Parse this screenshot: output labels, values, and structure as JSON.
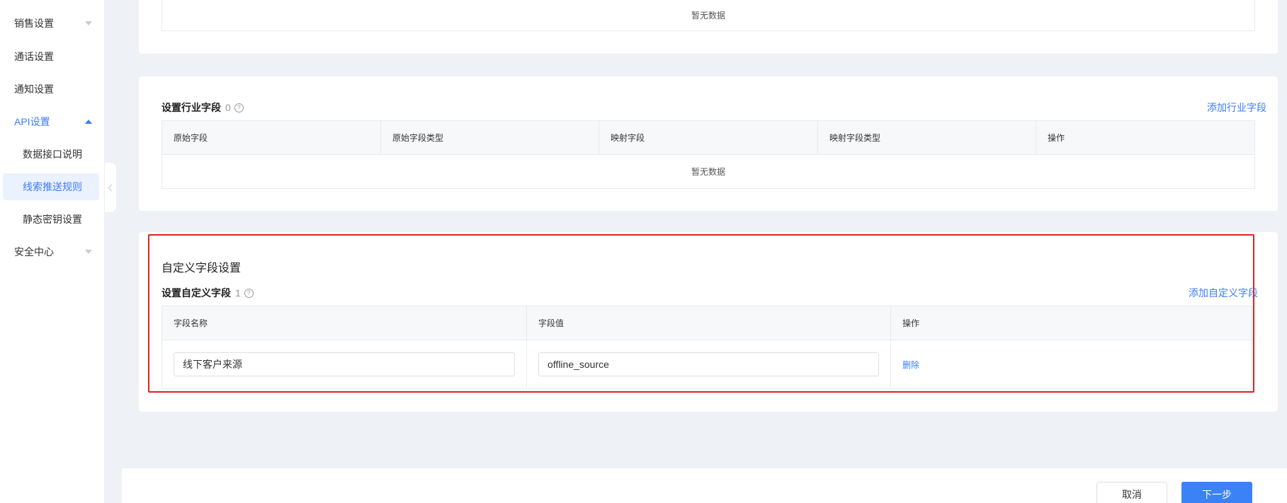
{
  "sidebar": {
    "items": [
      {
        "label": "销售设置"
      },
      {
        "label": "通话设置"
      },
      {
        "label": "通知设置"
      },
      {
        "label": "API设置"
      },
      {
        "label": "数据接口说明"
      },
      {
        "label": "线索推送规则"
      },
      {
        "label": "静态密钥设置"
      },
      {
        "label": "安全中心"
      }
    ]
  },
  "top_card": {
    "empty_text": "暂无数据"
  },
  "industry_fields": {
    "title": "设置行业字段",
    "count": "0",
    "add_label": "添加行业字段",
    "columns": [
      "原始字段",
      "原始字段类型",
      "映射字段",
      "映射字段类型",
      "操作"
    ],
    "empty_text": "暂无数据"
  },
  "custom_fields": {
    "section_title": "自定义字段设置",
    "title": "设置自定义字段",
    "count": "1",
    "add_label": "添加自定义字段",
    "columns": [
      "字段名称",
      "字段值",
      "操作"
    ],
    "rows": [
      {
        "name": "线下客户来源",
        "value": "offline_source",
        "action": "删除"
      }
    ]
  },
  "footer": {
    "cancel_label": "取消",
    "next_label": "下一步"
  },
  "colors": {
    "accent": "#3b7cff",
    "highlight_border": "#e02020"
  }
}
